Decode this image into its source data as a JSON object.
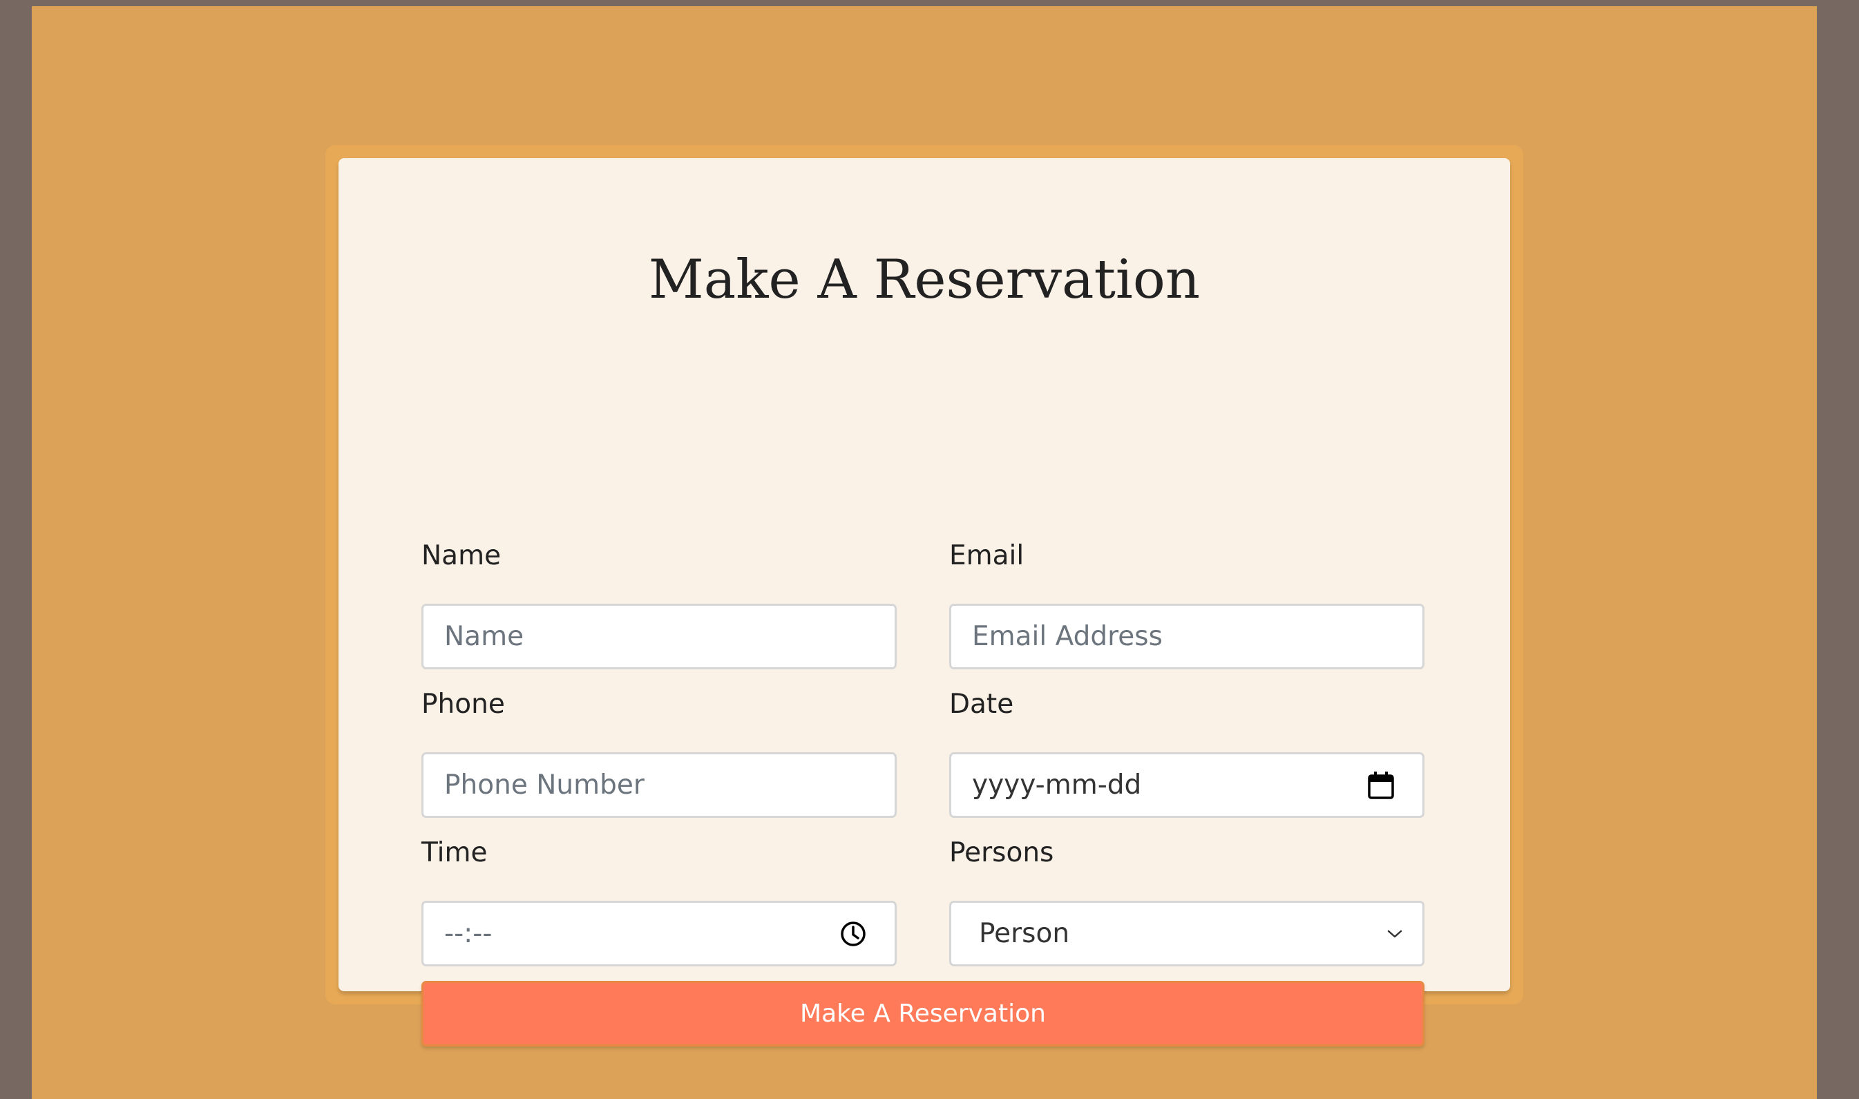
{
  "form": {
    "title": "Make A Reservation",
    "name": {
      "label": "Name",
      "placeholder": "Name"
    },
    "email": {
      "label": "Email",
      "placeholder": "Email Address"
    },
    "phone": {
      "label": "Phone",
      "placeholder": "Phone Number"
    },
    "date": {
      "label": "Date",
      "value": "yyyy-mm-dd",
      "icon": "calendar-icon"
    },
    "time": {
      "label": "Time",
      "value": "--:--",
      "icon": "clock-icon"
    },
    "persons": {
      "label": "Persons",
      "selected": "Person",
      "icon": "chevron-down-icon"
    },
    "submit_label": "Make A Reservation"
  },
  "colors": {
    "outer_background": "#776861",
    "page_background": "#dba258",
    "card_frame": "#e7a956",
    "card_background": "#faf1e7",
    "button": "#ff7a59",
    "button_text": "#ffffff"
  }
}
